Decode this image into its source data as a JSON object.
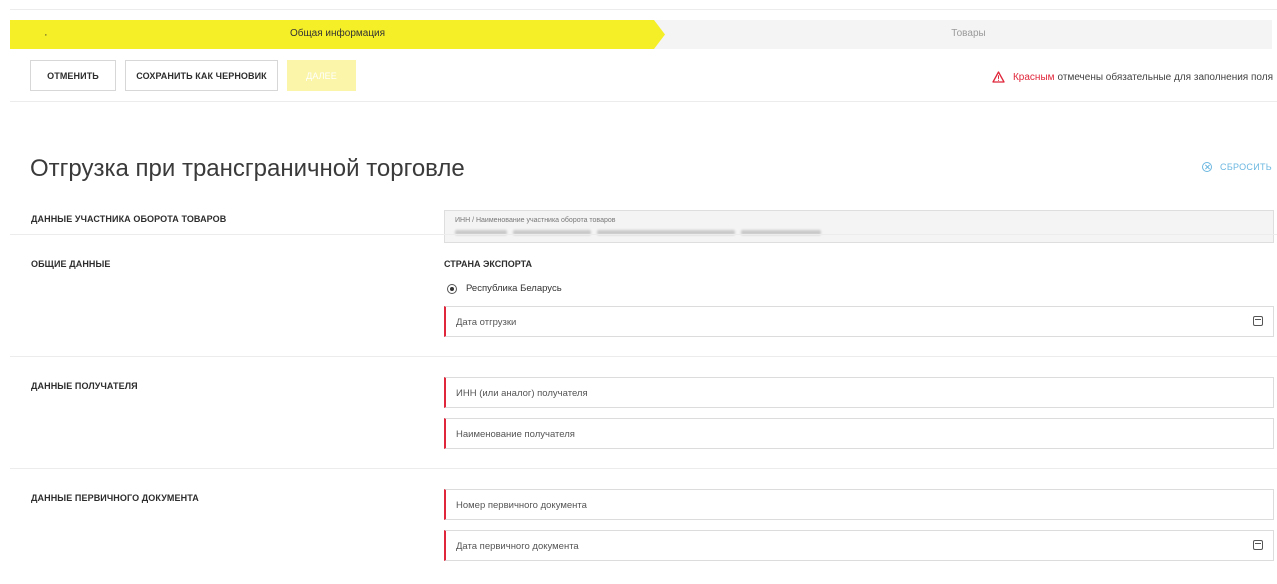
{
  "stepper": {
    "step1_bullet": "·",
    "step1_label": "Общая информация",
    "step2_label": "Товары",
    "active_color": "#f5ef28"
  },
  "toolbar": {
    "cancel_label": "ОТМЕНИТЬ",
    "draft_label": "СОХРАНИТЬ КАК ЧЕРНОВИК",
    "next_label": "ДАЛЕЕ"
  },
  "notice": {
    "icon": "warning-triangle-icon",
    "red_word": "Красным",
    "rest": "отмечены обязательные для заполнения поля"
  },
  "page": {
    "title": "Отгрузка при трансграничной торговле",
    "reset_label": "СБРОСИТЬ"
  },
  "sections": {
    "participant": {
      "label": "ДАННЫЕ УЧАСТНИКА ОБОРОТА ТОВАРОВ",
      "field_label": "ИНН / Наименование участника оборота товаров"
    },
    "general": {
      "label": "ОБЩИЕ ДАННЫЕ",
      "country_heading": "СТРАНА ЭКСПОРТА",
      "country_option": "Республика Беларусь",
      "shipment_date_placeholder": "Дата отгрузки"
    },
    "recipient": {
      "label": "ДАННЫЕ ПОЛУЧАТЕЛЯ",
      "inn_placeholder": "ИНН (или аналог) получателя",
      "name_placeholder": "Наименование получателя"
    },
    "primary_doc": {
      "label": "ДАННЫЕ ПЕРВИЧНОГО ДОКУМЕНТА",
      "number_placeholder": "Номер первичного документа",
      "date_placeholder": "Дата первичного документа"
    }
  },
  "colors": {
    "required": "#e0263a",
    "link": "#6bb7e0",
    "disabled_button": "#faf5a8"
  }
}
